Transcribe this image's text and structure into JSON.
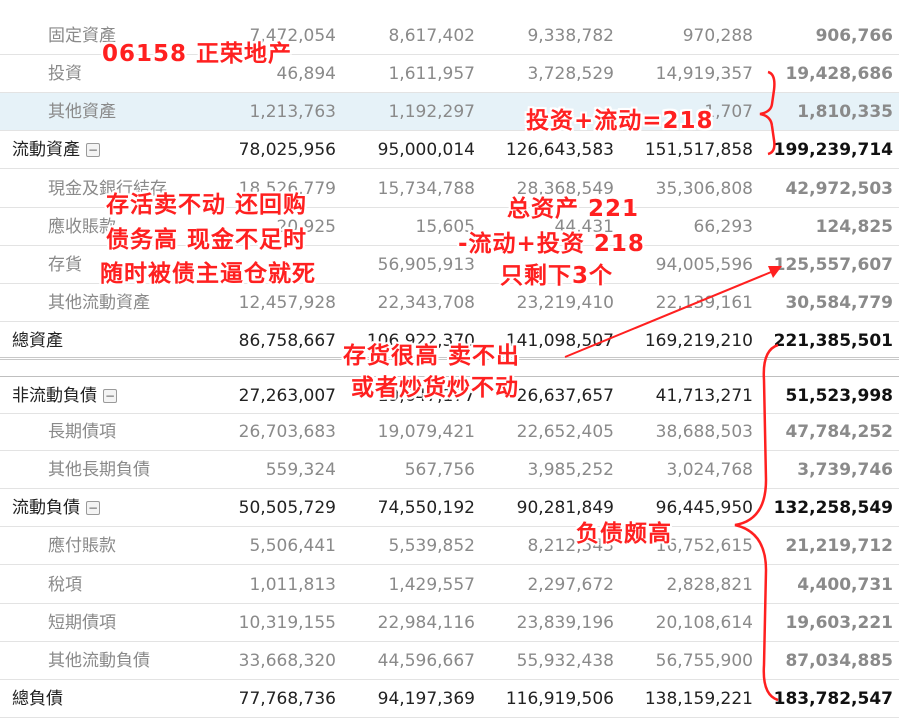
{
  "rows": [
    {
      "label": "固定資產",
      "type": "sub",
      "values": [
        "7,472,054",
        "8,617,402",
        "9,338,782",
        "970,288",
        "906,766"
      ]
    },
    {
      "label": "投資",
      "type": "sub",
      "values": [
        "46,894",
        "1,611,957",
        "3,728,529",
        "14,919,357",
        "19,428,686"
      ]
    },
    {
      "label": "其他資產",
      "type": "sub",
      "highlight": true,
      "values": [
        "1,213,763",
        "1,192,297",
        "",
        "1,707",
        "1,810,335"
      ]
    },
    {
      "label": "流動資產",
      "type": "main",
      "toggle": true,
      "values": [
        "78,025,956",
        "95,000,014",
        "126,643,583",
        "151,517,858",
        "199,239,714"
      ]
    },
    {
      "label": "現金及銀行結存",
      "type": "sub",
      "values": [
        "18,526,779",
        "15,734,788",
        "28,368,549",
        "35,306,808",
        "42,972,503"
      ]
    },
    {
      "label": "應收賬款",
      "type": "sub",
      "values": [
        "20,925",
        "15,605",
        "44,431",
        "66,293",
        "124,825"
      ]
    },
    {
      "label": "存貨",
      "type": "sub",
      "values": [
        "",
        "56,905,913",
        "",
        "94,005,596",
        "125,557,607"
      ]
    },
    {
      "label": "其他流動資產",
      "type": "sub",
      "values": [
        "12,457,928",
        "22,343,708",
        "23,219,410",
        "22,139,161",
        "30,584,779"
      ]
    },
    {
      "label": "總資產",
      "type": "main",
      "double": true,
      "values": [
        "86,758,667",
        "106,922,370",
        "141,098,507",
        "169,219,210",
        "221,385,501"
      ]
    },
    {
      "label": "非流動負債",
      "type": "main",
      "toggle": true,
      "values": [
        "27,263,007",
        "19,647,177",
        "26,637,657",
        "41,713,271",
        "51,523,998"
      ]
    },
    {
      "label": "長期債項",
      "type": "sub",
      "values": [
        "26,703,683",
        "19,079,421",
        "22,652,405",
        "38,688,503",
        "47,784,252"
      ]
    },
    {
      "label": "其他長期負債",
      "type": "sub",
      "values": [
        "559,324",
        "567,756",
        "3,985,252",
        "3,024,768",
        "3,739,746"
      ]
    },
    {
      "label": "流動負債",
      "type": "main",
      "toggle": true,
      "values": [
        "50,505,729",
        "74,550,192",
        "90,281,849",
        "96,445,950",
        "132,258,549"
      ]
    },
    {
      "label": "應付賬款",
      "type": "sub",
      "values": [
        "5,506,441",
        "5,539,852",
        "8,212,543",
        "16,752,615",
        "21,219,712"
      ]
    },
    {
      "label": "稅項",
      "type": "sub",
      "values": [
        "1,011,813",
        "1,429,557",
        "2,297,672",
        "2,828,821",
        "4,400,731"
      ]
    },
    {
      "label": "短期債項",
      "type": "sub",
      "values": [
        "10,319,155",
        "22,984,116",
        "23,839,196",
        "20,108,614",
        "19,603,221"
      ]
    },
    {
      "label": "其他流動負債",
      "type": "sub",
      "values": [
        "33,668,320",
        "44,596,667",
        "55,932,438",
        "56,755,900",
        "87,034,885"
      ]
    },
    {
      "label": "總負債",
      "type": "main",
      "values": [
        "77,768,736",
        "94,197,369",
        "116,919,506",
        "138,159,221",
        "183,782,547"
      ]
    }
  ],
  "toggle_symbol": "−",
  "annotations": {
    "title": "06158  正荣地产",
    "invest_flow": "投资+流动=218",
    "inventory_note_1": "存活卖不动 还回购",
    "inventory_note_2": "债务高 现金不足时",
    "inventory_note_3": "随时被债主逼仓就死",
    "total_note_1": "总资产 221",
    "total_note_2": "-流动+投资 218",
    "total_note_3": "只剩下3个",
    "stock_note_1": "存货很高 卖不出",
    "stock_note_2": "或者炒货炒不动",
    "debt_note": "负债颇高"
  },
  "colors": {
    "annotation": "#ff2020",
    "highlight_row": "#e6f2f8"
  }
}
